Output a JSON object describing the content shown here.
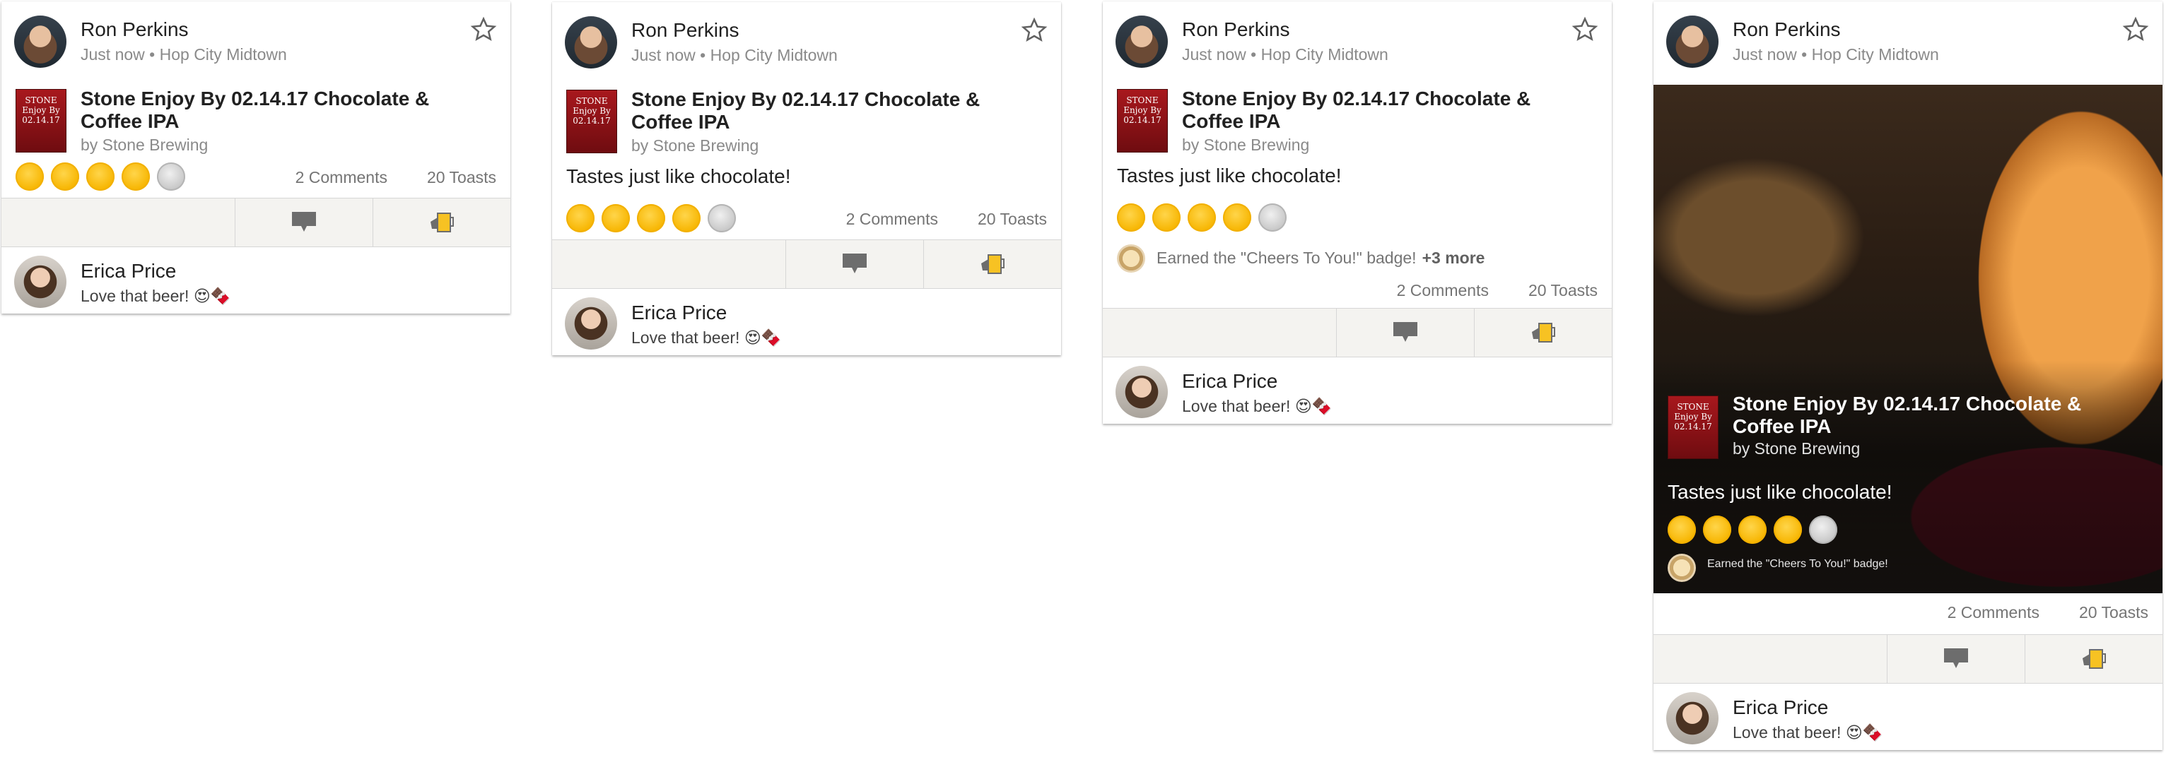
{
  "checkin": {
    "user_name": "Ron Perkins",
    "time": "Just now",
    "separator": "•",
    "venue": "Hop City Midtown",
    "beer_name": "Stone Enjoy By 02.14.17 Chocolate & Coffee IPA",
    "brewery": "by Stone Brewing",
    "note": "Tastes just like chocolate!",
    "rating": {
      "filled": 4,
      "total": 5
    },
    "comments": "2 Comments",
    "toasts": "20 Toasts",
    "badge_text": "Earned the \"Cheers To You!\" badge!",
    "badge_more": "+3 more",
    "label_lines": [
      "STONE",
      "Enjoy By",
      "02.14.17"
    ]
  },
  "comment": {
    "user_name": "Erica Price",
    "text": "Love that beer! 😍🍫"
  },
  "colors": {
    "cap_filled": "#f7b500",
    "cap_empty": "#c6c6c6",
    "action_bar": "#f4f3f0",
    "label_red": "#a8181d"
  },
  "icons": {
    "favorite": "star-outline-icon",
    "comment": "chat-bubble-icon",
    "toast": "toast-beer-icon",
    "badge": "badge-icon"
  }
}
